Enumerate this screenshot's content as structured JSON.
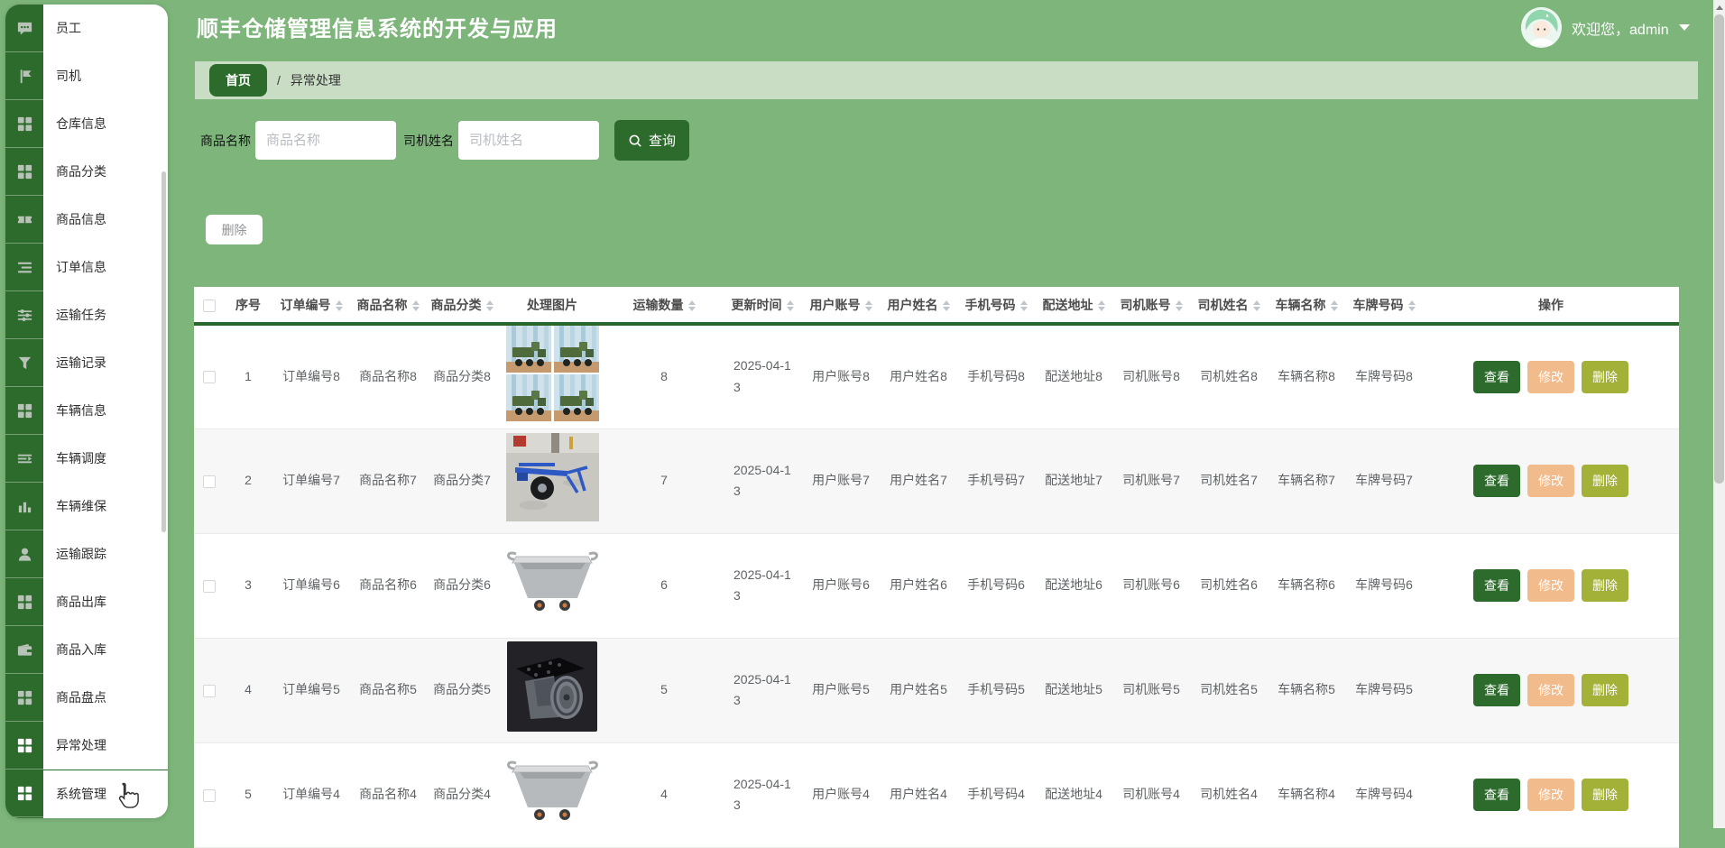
{
  "app": {
    "title": "顺丰仓储管理信息系统的开发与应用"
  },
  "user": {
    "welcome_prefix": "欢迎您，",
    "username": "admin"
  },
  "sidebar": {
    "items": [
      {
        "label": "员工",
        "icon": "chat-icon"
      },
      {
        "label": "司机",
        "icon": "flag-icon"
      },
      {
        "label": "仓库信息",
        "icon": "grid-icon"
      },
      {
        "label": "商品分类",
        "icon": "grid-icon"
      },
      {
        "label": "商品信息",
        "icon": "ticket-icon"
      },
      {
        "label": "订单信息",
        "icon": "list-icon"
      },
      {
        "label": "运输任务",
        "icon": "sliders-icon"
      },
      {
        "label": "运输记录",
        "icon": "funnel-icon"
      },
      {
        "label": "车辆信息",
        "icon": "grid-icon"
      },
      {
        "label": "车辆调度",
        "icon": "list-arrow-icon"
      },
      {
        "label": "车辆维保",
        "icon": "bar-chart-icon"
      },
      {
        "label": "运输跟踪",
        "icon": "user-icon"
      },
      {
        "label": "商品出库",
        "icon": "grid-icon"
      },
      {
        "label": "商品入库",
        "icon": "wallet-icon"
      },
      {
        "label": "商品盘点",
        "icon": "grid-icon"
      },
      {
        "label": "异常处理",
        "icon": "grid-icon",
        "active": true
      },
      {
        "label": "系统管理",
        "icon": "grid-icon",
        "active": true,
        "divided": true
      }
    ]
  },
  "breadcrumb": {
    "home": "首页",
    "separator": "/",
    "current": "异常处理"
  },
  "search": {
    "product_label": "商品名称",
    "product_placeholder": "商品名称",
    "product_value": "",
    "driver_label": "司机姓名",
    "driver_placeholder": "司机姓名",
    "driver_value": "",
    "query_label": "查询"
  },
  "toolbar": {
    "delete_label": "删除"
  },
  "table": {
    "columns": [
      {
        "key": "select",
        "label": "",
        "checkbox": true
      },
      {
        "key": "no",
        "label": "序号"
      },
      {
        "key": "order_no",
        "label": "订单编号",
        "sortable": true
      },
      {
        "key": "product_name",
        "label": "商品名称",
        "sortable": true
      },
      {
        "key": "category",
        "label": "商品分类",
        "sortable": true
      },
      {
        "key": "image",
        "label": "处理图片"
      },
      {
        "key": "quantity",
        "label": "运输数量",
        "sortable": true
      },
      {
        "key": "update_time",
        "label": "更新时间",
        "sortable": true
      },
      {
        "key": "user_account",
        "label": "用户账号",
        "sortable": true
      },
      {
        "key": "user_name",
        "label": "用户姓名",
        "sortable": true
      },
      {
        "key": "phone",
        "label": "手机号码",
        "sortable": true
      },
      {
        "key": "address",
        "label": "配送地址",
        "sortable": true
      },
      {
        "key": "driver_account",
        "label": "司机账号",
        "sortable": true
      },
      {
        "key": "driver_name",
        "label": "司机姓名",
        "sortable": true
      },
      {
        "key": "vehicle_name",
        "label": "车辆名称",
        "sortable": true
      },
      {
        "key": "plate",
        "label": "车牌号码",
        "sortable": true
      },
      {
        "key": "actions",
        "label": "操作"
      }
    ],
    "actions": {
      "view": "查看",
      "edit": "修改",
      "delete": "删除"
    },
    "rows": [
      {
        "no": "1",
        "order_no": "订单编号8",
        "product_name": "商品名称8",
        "category": "商品分类8",
        "image": "military-trucks",
        "quantity": "8",
        "update_time": "2025-04-13",
        "user_account": "用户账号8",
        "user_name": "用户姓名8",
        "phone": "手机号码8",
        "address": "配送地址8",
        "driver_account": "司机账号8",
        "driver_name": "司机姓名8",
        "vehicle_name": "车辆名称8",
        "plate": "车牌号码8"
      },
      {
        "no": "2",
        "order_no": "订单编号7",
        "product_name": "商品名称7",
        "category": "商品分类7",
        "image": "blue-trailer",
        "quantity": "7",
        "update_time": "2025-04-13",
        "user_account": "用户账号7",
        "user_name": "用户姓名7",
        "phone": "手机号码7",
        "address": "配送地址7",
        "driver_account": "司机账号7",
        "driver_name": "司机姓名7",
        "vehicle_name": "车辆名称7",
        "plate": "车牌号码7"
      },
      {
        "no": "3",
        "order_no": "订单编号6",
        "product_name": "商品名称6",
        "category": "商品分类6",
        "image": "metal-cart",
        "quantity": "6",
        "update_time": "2025-04-13",
        "user_account": "用户账号6",
        "user_name": "用户姓名6",
        "phone": "手机号码6",
        "address": "配送地址6",
        "driver_account": "司机账号6",
        "driver_name": "司机姓名6",
        "vehicle_name": "车辆名称6",
        "plate": "车牌号码6"
      },
      {
        "no": "4",
        "order_no": "订单编号5",
        "product_name": "商品名称5",
        "category": "商品分类5",
        "image": "caster-wheel",
        "quantity": "5",
        "update_time": "2025-04-13",
        "user_account": "用户账号5",
        "user_name": "用户姓名5",
        "phone": "手机号码5",
        "address": "配送地址5",
        "driver_account": "司机账号5",
        "driver_name": "司机姓名5",
        "vehicle_name": "车辆名称5",
        "plate": "车牌号码5"
      },
      {
        "no": "5",
        "order_no": "订单编号4",
        "product_name": "商品名称4",
        "category": "商品分类4",
        "image": "metal-cart",
        "quantity": "4",
        "update_time": "2025-04-13",
        "user_account": "用户账号4",
        "user_name": "用户姓名4",
        "phone": "手机号码4",
        "address": "配送地址4",
        "driver_account": "司机账号4",
        "driver_name": "司机姓名4",
        "vehicle_name": "车辆名称4",
        "plate": "车牌号码4"
      }
    ]
  },
  "colors": {
    "page_green": "#7db57b",
    "primary_green": "#2c6b2c",
    "breadcrumb_green": "#c9dcc4",
    "edit_peach": "#f2bb8b",
    "delete_olive": "#a3b138"
  }
}
